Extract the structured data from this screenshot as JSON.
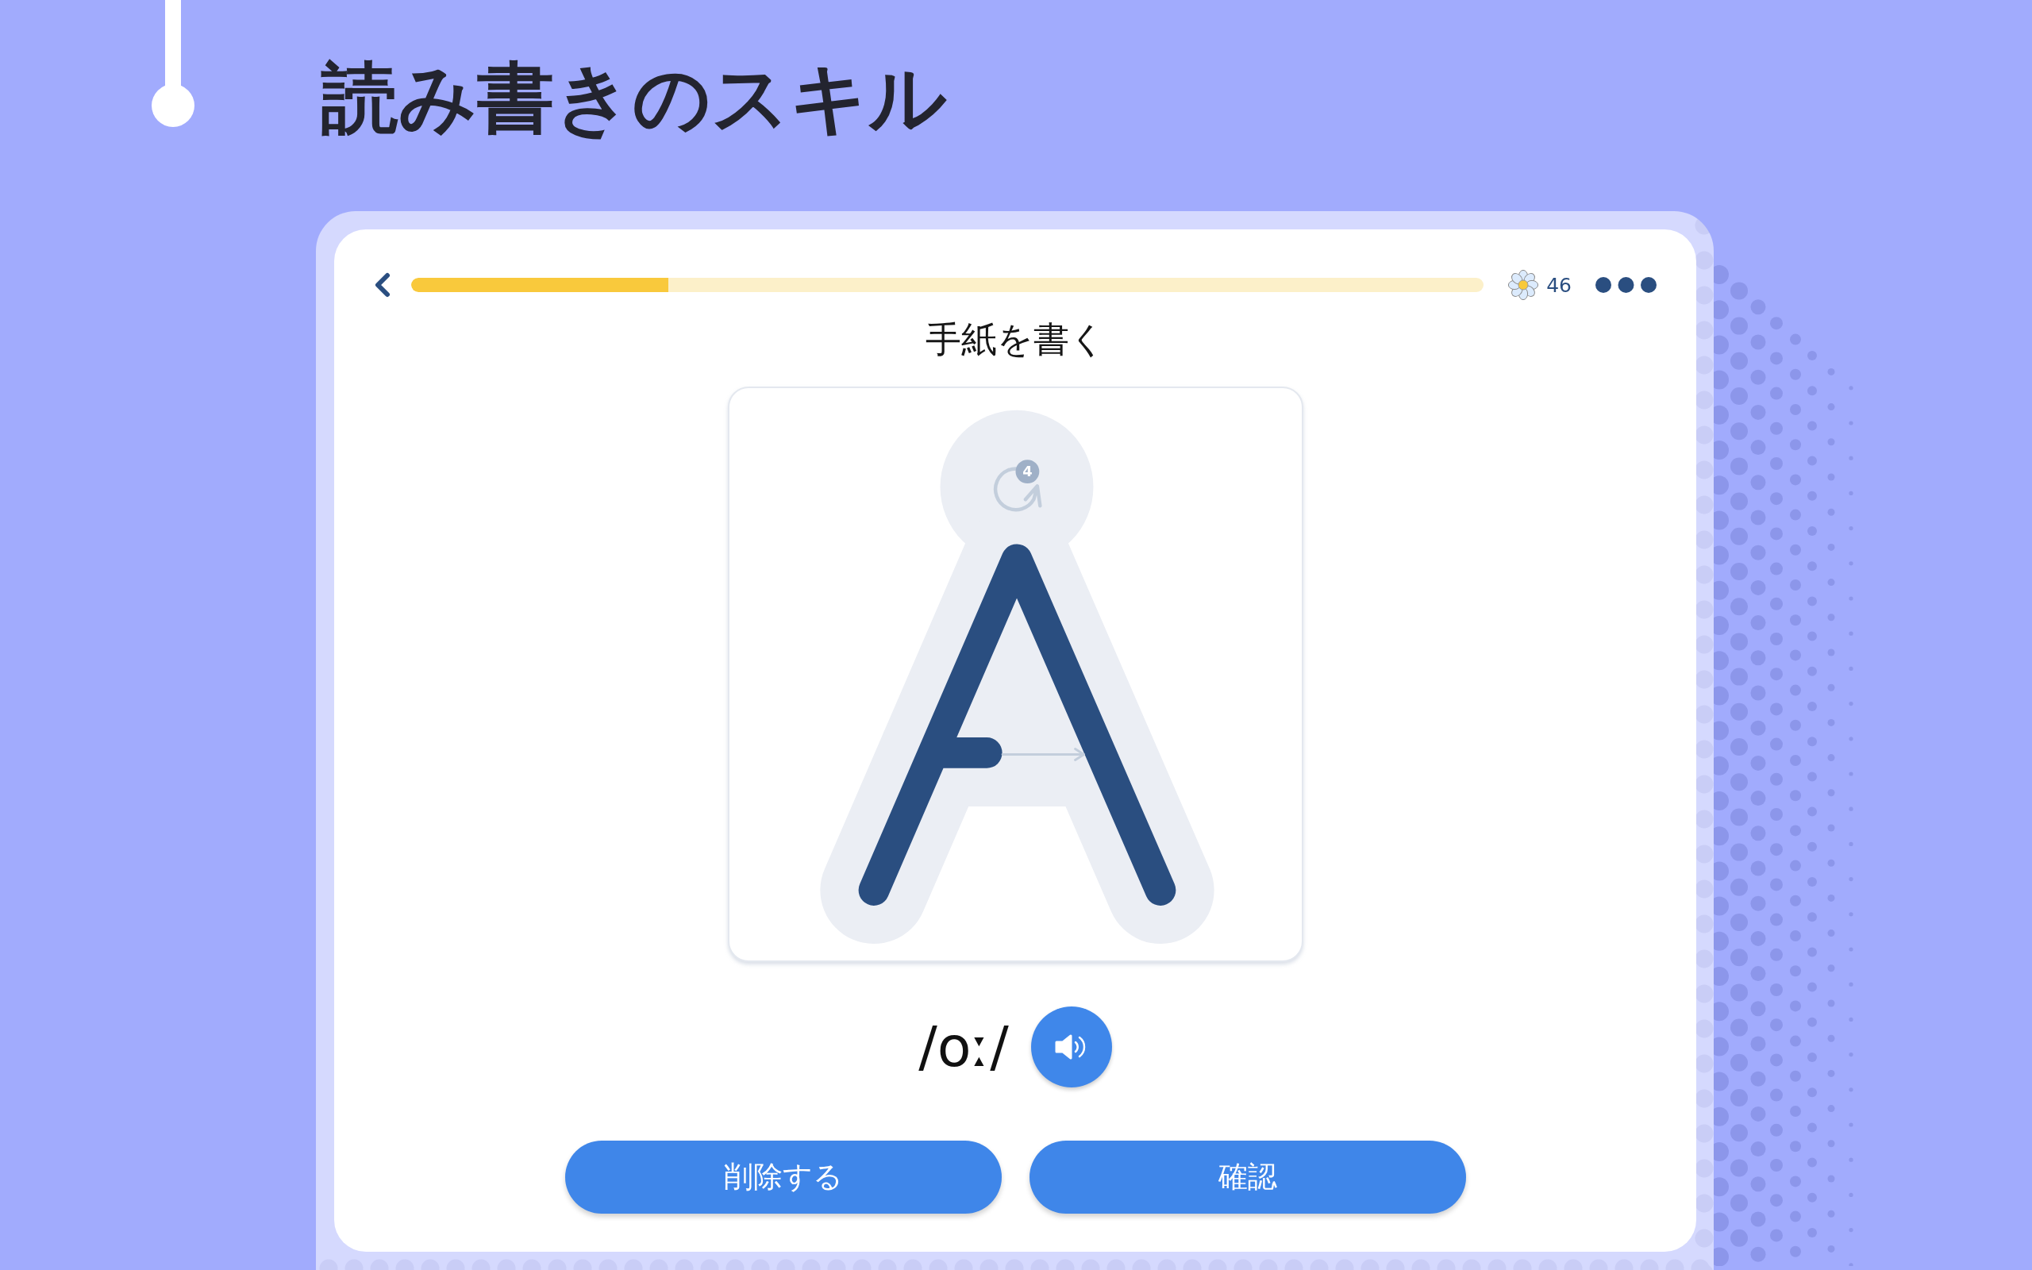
{
  "page_title": "読み書きのスキル",
  "lesson": {
    "progress": {
      "level": 0.24
    },
    "flower_count": "46",
    "prompt": "手紙を書く",
    "tracing": {
      "stroke_number": "4"
    },
    "phonetic": "/oː/",
    "buttons": [
      {
        "label": "削除する"
      },
      {
        "label": "確認"
      }
    ]
  }
}
